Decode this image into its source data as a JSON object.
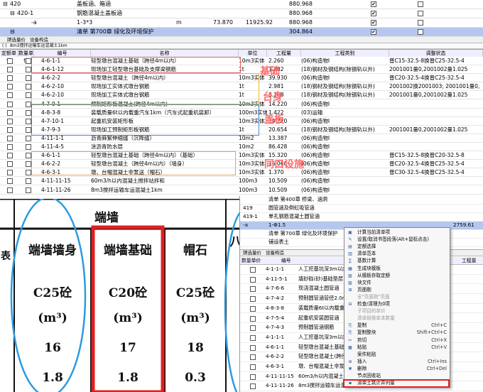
{
  "top_grid": {
    "rows": [
      {
        "indent": 1,
        "toggle": "⊟",
        "code": "420",
        "name": "盖板涵、箱涵",
        "unit": "",
        "qty": "",
        "price": "",
        "amount": "880.968",
        "c1": true,
        "c2": false
      },
      {
        "indent": 2,
        "toggle": "⊟",
        "code": "420-1",
        "name": "钢筋混凝土盖板涵",
        "unit": "",
        "qty": "",
        "price": "",
        "amount": "880.968",
        "c1": true,
        "c2": false
      },
      {
        "indent": 3,
        "toggle": "",
        "code": "-a",
        "name": "1-3*3",
        "unit": "m",
        "qty": "73.870",
        "price": "11925.92",
        "amount": "880.968",
        "c1": true,
        "c2": false
      },
      {
        "indent": 2,
        "toggle": "⊟",
        "code": "",
        "name": "清单 第700章 绿化及环境保护",
        "unit": "",
        "qty": "",
        "price": "",
        "amount": "304.864",
        "c1": true,
        "c2": false
      }
    ]
  },
  "toolbar": {
    "tab1": "牌选量价",
    "tab2": "设备构造",
    "path": "8m3搅拌运输车运混凝土1km"
  },
  "mid_grid": {
    "headers": {
      "c0": "定额单价",
      "c1": "数量单价",
      "code": "编号",
      "name": "名称",
      "unit": "单位",
      "qty": "工程量",
      "type": "工程类别",
      "adjust": "调整状态"
    },
    "rows": [
      {
        "code": "4-6-1-1",
        "name": "轻型墩台混凝土基础（跨径4m以内）",
        "unit": "10m3实体",
        "qty": "2.260",
        "type": "(06)构造物I",
        "adjust": "普C15-32.5-8换普C25-32.5-4"
      },
      {
        "code": "4-6-1-12",
        "name": "现场加工轻型墩台基础及支撑梁钢筋",
        "unit": "1t",
        "qty": "1.882",
        "type": "(18)钢材及钢结构(除钢轨以外)",
        "adjust": "2001001量0,2001002量1.025"
      },
      {
        "code": "4-6-2-2",
        "name": "轻型墩台混凝土（跨径4m以内）",
        "unit": "10m3实体",
        "qty": "39.930",
        "type": "(06)构造物I",
        "adjust": "普C20-32.5-4换普C25-32.5-4"
      },
      {
        "code": "4-6-2-10",
        "name": "现场加工实体式墩台钢筋",
        "unit": "1t",
        "qty": "2.981",
        "type": "(18)钢材及钢结构(除钢轨以外)",
        "adjust": "2001002换2001003; 2001001量0,"
      },
      {
        "code": "4-6-2-10",
        "name": "现场加工实体式墩台钢筋",
        "unit": "1t",
        "qty": "3.268",
        "type": "(18)钢材及钢结构(除钢轨以外)",
        "adjust": "2001001量0,2001002量1.025"
      },
      {
        "code": "4-7-9-1",
        "name": "预制矩形板混凝土(跨径4m以内)",
        "unit": "10m3实体",
        "qty": "14.220",
        "type": "(06)构造物I",
        "adjust": ""
      },
      {
        "code": "4-8-3-8",
        "name": "装载质量6t以内载重汽车1km（汽车式起重机装卸）",
        "unit": "100m3实体",
        "qty": "1.422",
        "type": "(03)运输",
        "adjust": ""
      },
      {
        "code": "4-7-10-1",
        "name": "起重机安装矩形板",
        "unit": "10m3实体",
        "qty": "14.220",
        "type": "(06)构造物I",
        "adjust": ""
      },
      {
        "code": "4-7-9-3",
        "name": "现场加工预制矩形板钢筋",
        "unit": "1t",
        "qty": "20.654",
        "type": "(18)钢材及钢结构(除钢轨以外)",
        "adjust": "2001001量0,2001002量1.025"
      },
      {
        "code": "4-11-1-1",
        "name": "沥青麻絮伸缩缝（沉降缝）",
        "unit": "10m2",
        "qty": "13.387",
        "type": "(06)构造物I",
        "adjust": ""
      },
      {
        "code": "4-11-4-5",
        "name": "涂沥青防水层",
        "unit": "10m2",
        "qty": "86.428",
        "type": "(06)构造物I",
        "adjust": ""
      },
      {
        "code": "4-6-1-1",
        "name": "轻型墩台混凝土基础（跨径4m以内）（基础）",
        "unit": "10m3实体",
        "qty": "15.320",
        "type": "(06)构造物I",
        "adjust": "普C15-32.5-8换普C20-32.5-8"
      },
      {
        "code": "4-6-2-2",
        "name": "轻型墩台混凝土（跨径4m以内）（墙身）",
        "unit": "10m3实体",
        "qty": "16.060",
        "type": "(06)构造物I",
        "adjust": "普C20-32.5-4换普C25-32.5-4"
      },
      {
        "code": "4-6-3-1",
        "name": "墩、台帽混凝土非泵送（帽石）",
        "unit": "10m3实体",
        "qty": "1.370",
        "type": "(06)构造物I",
        "adjust": "普C30-32.5-4换普C25-32.5-4"
      },
      {
        "code": "4-11-11-15",
        "name": "60m3/h以内混凝土搅拌站拌和",
        "unit": "100m3",
        "qty": "10.509",
        "type": "(06)构造物I",
        "adjust": ""
      },
      {
        "code": "4-11-11-26",
        "name": "8m3搅拌运输车运混凝土1km",
        "unit": "100m3",
        "qty": "10.509",
        "type": "(06)构造物I",
        "adjust": ""
      }
    ]
  },
  "annotations": {
    "foundation": "基础",
    "cap": "台身",
    "slab": "盖板",
    "same": "同口设施"
  },
  "design_table": {
    "header": "端墙",
    "columns": [
      {
        "name": "端墙墙身",
        "concrete": "C25砼",
        "unit": "(m³)",
        "v1": "16",
        "v2": "1.8"
      },
      {
        "name": "端墙基础",
        "concrete": "C20砼",
        "unit": "(m³)",
        "v1": "17",
        "v2": "1.8"
      },
      {
        "name": "帽石",
        "concrete": "C25砼",
        "unit": "(m³)",
        "v1": "18",
        "v2": "0.3"
      }
    ],
    "left_label": "表",
    "right_partial": "八"
  },
  "right_window": {
    "top_rows": [
      {
        "code": "",
        "name": "清单 第400章 桥梁、涵洞",
        "qty": "",
        "amt": ""
      },
      {
        "code": "419",
        "name": "圆管涵及倒虹吸管涵",
        "qty": "",
        "amt": ""
      },
      {
        "code": "419-1",
        "name": "单孔钢筋混凝土圆管涵",
        "qty": "",
        "amt": ""
      },
      {
        "code": "-a",
        "name": "1-Φ1.5",
        "qty": "",
        "amt": "2759.61"
      },
      {
        "code": "",
        "name": "清单 第700章 绿化及环境保护",
        "qty": "",
        "amt": ""
      },
      {
        "code": "",
        "name": "铺设表土",
        "qty": "",
        "amt": ""
      }
    ],
    "tabs": {
      "a": "牌选量价",
      "b": "设备构造"
    },
    "header": {
      "c0": "数量单价",
      "code": "编号",
      "right": "工程量"
    },
    "rows": [
      {
        "code": "4-1-1-1",
        "name": "人工挖基坑深3m以内"
      },
      {
        "code": "4-11-5-1",
        "name": "填砂砾(砂)基础垫层"
      },
      {
        "code": "4-7-6-6",
        "name": "现浇混凝土圆管涵"
      },
      {
        "code": "4-7-4-2",
        "name": "预制圆管涵管径2.0m"
      },
      {
        "code": "4-8-3-8",
        "name": "装载质量6t以内载重"
      },
      {
        "code": "4-7-5-4",
        "name": "起重机安装圆管涵"
      },
      {
        "code": "4-7-4-3",
        "name": "预制圆管涵钢筋"
      },
      {
        "code": "4-1-1-1",
        "name": "人工挖基坑深3m以内"
      },
      {
        "code": "4-6-1-1",
        "name": "轻型墩台混凝土基础"
      },
      {
        "code": "4-6-2-2",
        "name": "轻型墩台混凝土(跨径"
      },
      {
        "code": "4-6-3-1",
        "name": "墩、台帽混凝土非泵"
      },
      {
        "code": "4-11-11-15",
        "name": "60m3/h以内混凝土搅"
      },
      {
        "code": "4-11-11-26",
        "name": "8m3搅拌运输车运混凝"
      }
    ]
  },
  "context_menu": {
    "items": [
      {
        "label": "计算当前清单项",
        "sc": "",
        "dis": false
      },
      {
        "label": "设置/取消书签段落(Alt+鼠标点击)",
        "sc": "",
        "dis": false
      },
      {
        "label": "定额选择",
        "sc": "",
        "dis": false
      },
      {
        "label": "清单范本",
        "sc": "",
        "dis": false
      },
      {
        "label": "基数计算",
        "sc": "",
        "dis": false
      },
      {
        "label": "生成块模板",
        "sc": "",
        "dis": false
      },
      {
        "label": "从模板存取定额",
        "sc": "",
        "dis": false
      },
      {
        "label": "块文件",
        "sc": "",
        "dis": false
      },
      {
        "label": "页面剔",
        "sc": "",
        "dis": false
      },
      {
        "label": "全\"页面剔\"页面",
        "sc": "",
        "dis": true
      },
      {
        "label": "检查/清理为0项",
        "sc": "",
        "dis": false
      },
      {
        "label": "子项目的单价",
        "sc": "",
        "dis": true
      },
      {
        "label": "清单替换单本数量",
        "sc": "",
        "dis": true
      },
      {
        "label": "复制",
        "sc": "Ctrl+C",
        "dis": false
      },
      {
        "label": "复制整块",
        "sc": "Shift+Ctrl+C",
        "dis": false
      },
      {
        "label": "剪切",
        "sc": "Ctrl+X",
        "dis": false
      },
      {
        "label": "粘贴",
        "sc": "Ctrl+V",
        "dis": false
      },
      {
        "label": "案件粘贴",
        "sc": "",
        "dis": false
      },
      {
        "label": "插入",
        "sc": "Ctrl+Ins",
        "dis": false
      },
      {
        "label": "删除",
        "sc": "Ctrl+Del",
        "dis": false
      },
      {
        "label": "节点回收站",
        "sc": "",
        "dis": false
      },
      {
        "label": "清单土筑计并列量",
        "sc": "",
        "dis": false
      }
    ]
  }
}
